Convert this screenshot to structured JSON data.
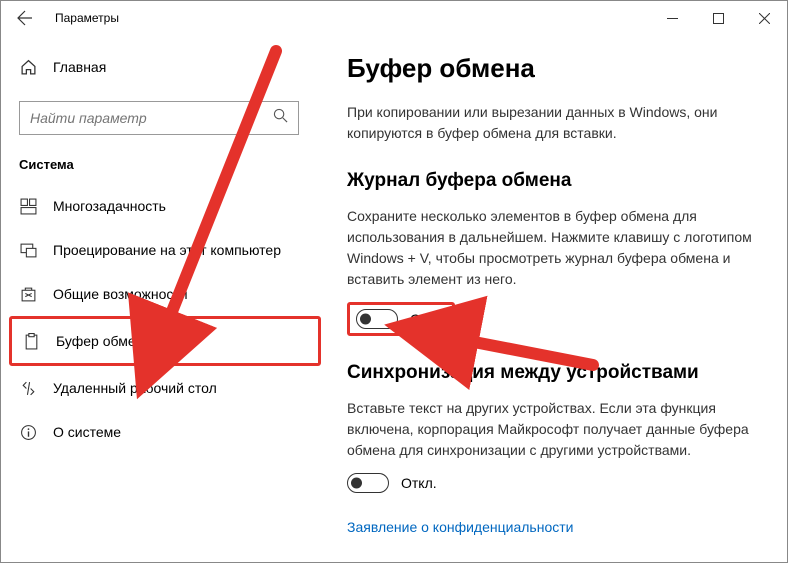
{
  "window": {
    "title": "Параметры"
  },
  "sidebar": {
    "home": "Главная",
    "search_placeholder": "Найти параметр",
    "section": "Система",
    "items": [
      {
        "label": "Многозадачность"
      },
      {
        "label": "Проецирование на этот компьютер"
      },
      {
        "label": "Общие возможности"
      },
      {
        "label": "Буфер обмена"
      },
      {
        "label": "Удаленный рабочий стол"
      },
      {
        "label": "О системе"
      }
    ]
  },
  "main": {
    "title": "Буфер обмена",
    "intro": "При копировании или вырезании данных в Windows, они копируются в буфер обмена для вставки.",
    "history": {
      "title": "Журнал буфера обмена",
      "desc": "Сохраните несколько элементов в буфер обмена для использования в дальнейшем. Нажмите клавишу с логотипом Windows + V, чтобы просмотреть журнал буфера обмена и вставить элемент из него.",
      "state": "Откл."
    },
    "sync": {
      "title": "Синхронизация между устройствами",
      "desc": "Вставьте текст на других устройствах. Если эта функция включена, корпорация Майкрософт получает данные буфера обмена для синхронизации с другими устройствами.",
      "state": "Откл."
    },
    "privacy_link": "Заявление о конфиденциальности"
  }
}
